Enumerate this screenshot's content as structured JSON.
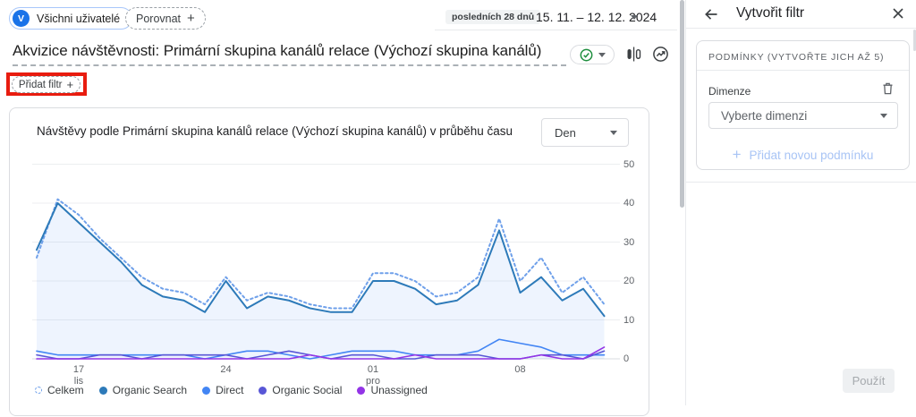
{
  "header": {
    "audience_avatar": "V",
    "audience_chip": "Všichni uživatelé",
    "compare_chip": "Porovnat",
    "plus": "+",
    "date_range_label": "posledních 28 dnů",
    "date_range": "15. 11. – 12. 12. 2024"
  },
  "report": {
    "title": "Akvizice návštěvnosti: Primární skupina kanálů relace (Výchozí skupina kanálů)",
    "add_filter_label": "Přidat filtr",
    "annotation_color": "#e81c0f"
  },
  "chart_card": {
    "title": "Návštěvy podle Primární skupina kanálů relace (Výchozí skupina kanálů) v průběhu času",
    "granularity": "Den"
  },
  "chart_data": {
    "type": "line",
    "title": "Návštěvy podle Primární skupina kanálů relace (Výchozí skupina kanálů) v průběhu času",
    "x_unit": "Den",
    "x_range": [
      "15. 11. 2024",
      "12. 12. 2024"
    ],
    "ylim": [
      0,
      50
    ],
    "yticks": [
      0,
      10,
      20,
      30,
      40,
      50
    ],
    "grid": true,
    "legend_position": "bottom",
    "xticks": [
      {
        "day": 2,
        "label": "17",
        "sub": "lis"
      },
      {
        "day": 9,
        "label": "24",
        "sub": ""
      },
      {
        "day": 16,
        "label": "01",
        "sub": "pro"
      },
      {
        "day": 23,
        "label": "08",
        "sub": ""
      }
    ],
    "series": [
      {
        "name": "Celkem",
        "color": "#6fa0ea",
        "style": "dashed",
        "fill": false,
        "values": [
          26,
          41,
          37,
          31,
          26,
          21,
          18,
          17,
          14,
          21,
          15,
          17,
          16,
          14,
          13,
          13,
          22,
          22,
          20,
          16,
          17,
          21,
          36,
          20,
          26,
          17,
          21,
          14
        ]
      },
      {
        "name": "Organic Search",
        "color": "#2d7ab9",
        "style": "solid",
        "fill": true,
        "values": [
          28,
          40,
          35,
          30,
          25,
          19,
          16,
          15,
          12,
          20,
          13,
          16,
          15,
          13,
          12,
          12,
          20,
          20,
          18,
          14,
          15,
          19,
          33,
          17,
          21,
          15,
          18,
          11
        ]
      },
      {
        "name": "Direct",
        "color": "#4285f4",
        "style": "solid",
        "fill": false,
        "values": [
          2,
          1,
          1,
          1,
          1,
          1,
          1,
          1,
          0,
          1,
          2,
          2,
          1,
          0,
          1,
          2,
          2,
          2,
          1,
          1,
          1,
          2,
          5,
          4,
          3,
          1,
          1,
          1
        ]
      },
      {
        "name": "Organic Social",
        "color": "#5856d6",
        "style": "solid",
        "fill": false,
        "values": [
          1,
          0,
          0,
          1,
          1,
          0,
          1,
          1,
          1,
          1,
          0,
          1,
          2,
          1,
          0,
          1,
          1,
          0,
          0,
          1,
          1,
          1,
          0,
          0,
          1,
          1,
          0,
          2
        ]
      },
      {
        "name": "Unassigned",
        "color": "#9334e6",
        "style": "solid",
        "fill": false,
        "values": [
          0,
          0,
          0,
          0,
          0,
          0,
          0,
          0,
          0,
          0,
          0,
          0,
          0,
          1,
          0,
          0,
          0,
          0,
          1,
          0,
          0,
          0,
          0,
          0,
          1,
          0,
          0,
          3
        ]
      }
    ]
  },
  "panel": {
    "title": "Vytvořit filtr",
    "conditions_header": "PODMÍNKY (VYTVOŘTE JICH AŽ 5)",
    "dimension_label": "Dimenze",
    "dimension_placeholder": "Vyberte dimenzi",
    "add_condition_label": "Přidat novou podmínku",
    "apply_label": "Použít"
  }
}
